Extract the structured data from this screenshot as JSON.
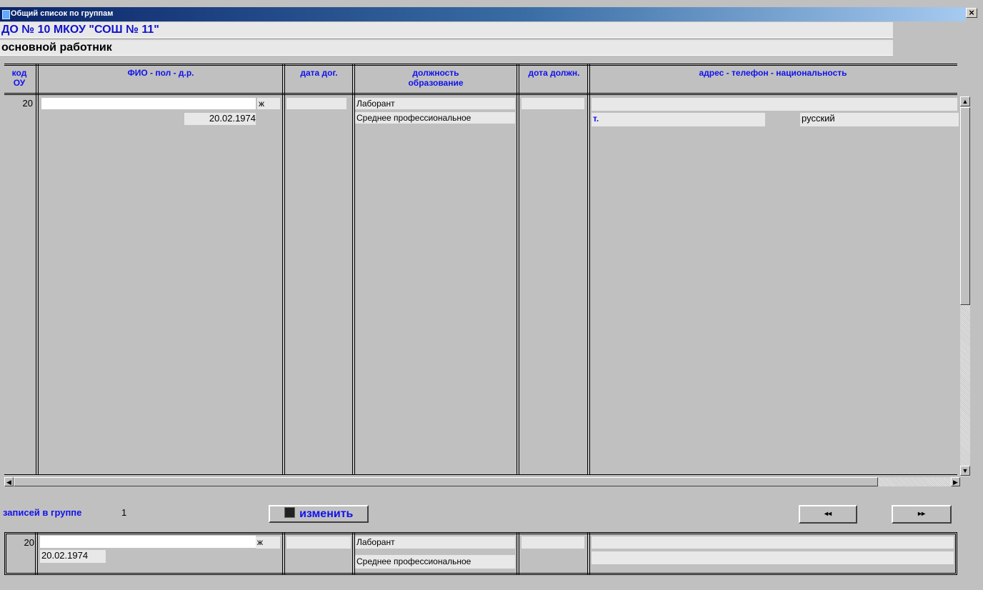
{
  "window": {
    "title": "Общий список по группам",
    "close_label": "×"
  },
  "header": {
    "org_name": "ДО № 10 МКОУ \"СОШ № 11\"",
    "category": "основной работник"
  },
  "columns": {
    "code": "код ОУ",
    "fio": "ФИО - пол - д.р.",
    "contract_date": "дата дог.",
    "position": "должность образование",
    "position_date": "дота должн.",
    "address": "адрес - телефон - национальность"
  },
  "record": {
    "code": "20",
    "gender": "ж",
    "birth_date": "20.02.1974",
    "position": "Лаборант",
    "education": "Среднее профессиональное",
    "phone_prefix": "т.",
    "nationality": "русский"
  },
  "footer": {
    "count_label": "записей в группе",
    "count_value": "1",
    "edit_button": "изменить",
    "prev_symbol": "◂◂",
    "next_symbol": "▸▸"
  },
  "preview": {
    "code": "20",
    "gender": "ж",
    "birth_date": "20.02.1974",
    "position": "Лаборант",
    "education": "Среднее профессиональное"
  }
}
